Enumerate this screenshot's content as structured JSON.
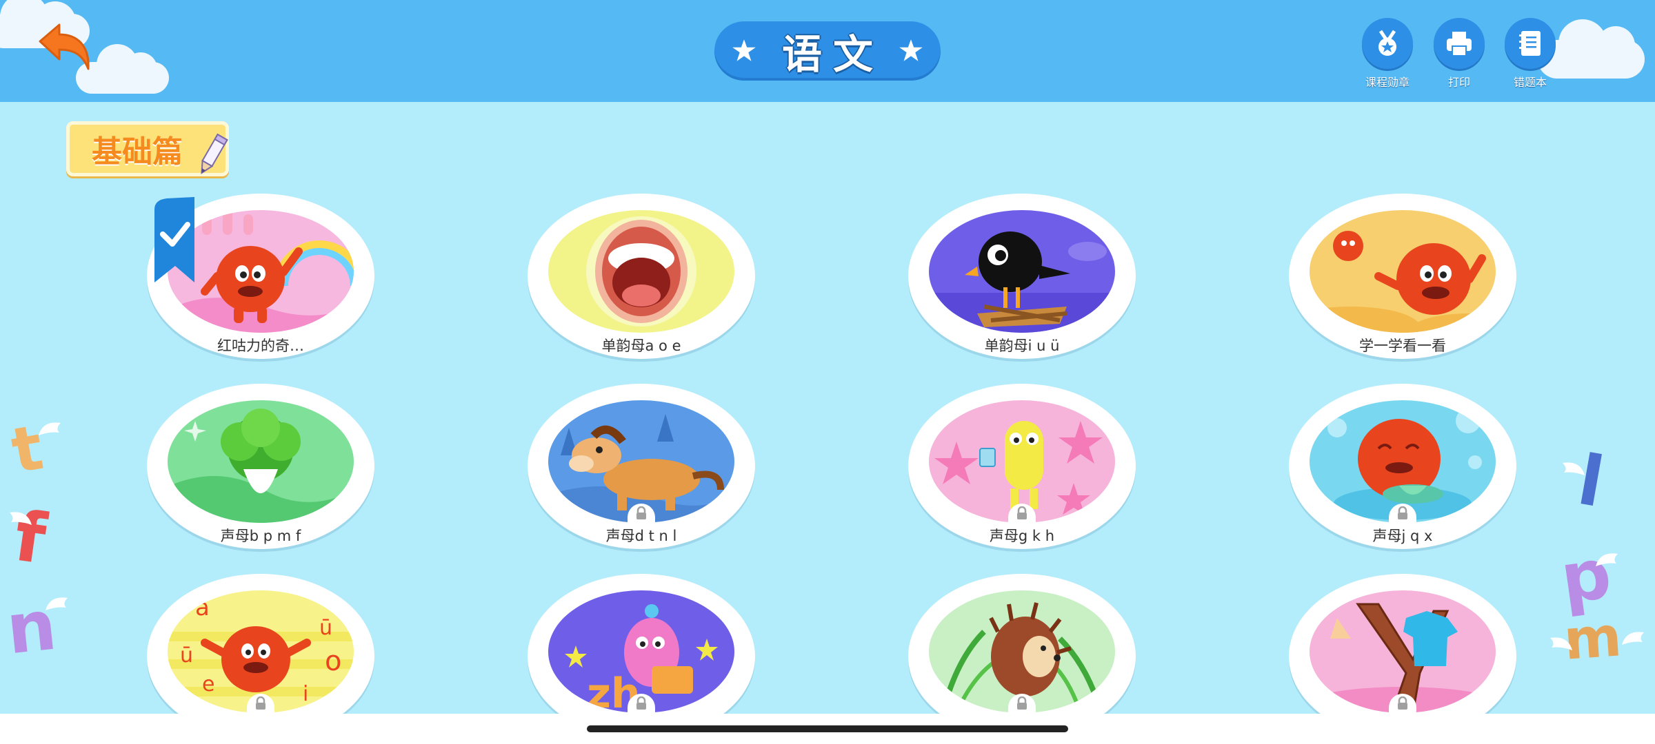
{
  "header": {
    "title": "语文",
    "buttons": [
      {
        "key": "medal",
        "label": "课程勋章",
        "icon": "medal-icon"
      },
      {
        "key": "print",
        "label": "打印",
        "icon": "printer-icon"
      },
      {
        "key": "mistakes",
        "label": "错题本",
        "icon": "notebook-icon"
      }
    ]
  },
  "section": {
    "label": "基础篇"
  },
  "lessons": [
    {
      "label": "红咕力的奇…",
      "locked": false,
      "completed": true
    },
    {
      "label": "单韵母a o e",
      "locked": false,
      "completed": false
    },
    {
      "label": "单韵母i u ü",
      "locked": false,
      "completed": false
    },
    {
      "label": "学一学看一看",
      "locked": false,
      "completed": false
    },
    {
      "label": "声母b p m f",
      "locked": false,
      "completed": false
    },
    {
      "label": "声母d t n l",
      "locked": true,
      "completed": false
    },
    {
      "label": "声母g k h",
      "locked": true,
      "completed": false
    },
    {
      "label": "声母j q x",
      "locked": true,
      "completed": false
    },
    {
      "label": "",
      "locked": true,
      "completed": false
    },
    {
      "label": "",
      "locked": true,
      "completed": false
    },
    {
      "label": "",
      "locked": true,
      "completed": false
    },
    {
      "label": "",
      "locked": true,
      "completed": false
    }
  ],
  "art_text": {
    "a": "a",
    "o": "o",
    "e": "e",
    "i": "i",
    "u": "u",
    "u_bar": "ū",
    "zh": "zh"
  },
  "side_letters": {
    "t": "t",
    "f": "f",
    "n": "n",
    "l": "l",
    "p": "p",
    "m": "m"
  },
  "colors": {
    "header_bg": "#55b9f3",
    "page_bg": "#b3ecfb",
    "accent_blue": "#2e8fe6",
    "section_yellow": "#fde27a",
    "section_text": "#f58a1f",
    "back_orange": "#f5761f"
  }
}
